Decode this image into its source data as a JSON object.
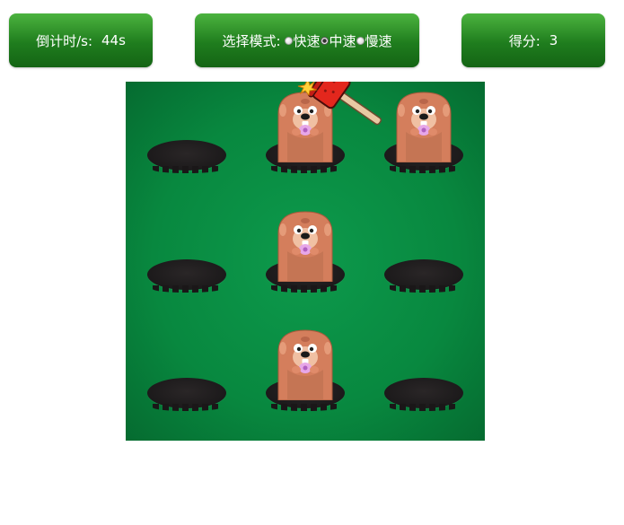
{
  "header": {
    "timer": {
      "label": "倒计时/s:",
      "value": "44s"
    },
    "mode": {
      "label": "选择模式:",
      "options": [
        {
          "label": "快速",
          "checked": false
        },
        {
          "label": "中速",
          "checked": true
        },
        {
          "label": "慢速",
          "checked": false
        }
      ]
    },
    "score": {
      "label": "得分:",
      "value": "3"
    }
  },
  "board": {
    "rows": 3,
    "cols": 3,
    "moles_up": [
      1,
      2,
      4,
      7
    ],
    "hit_mole": 1,
    "colors": {
      "grass": "#08883f",
      "hole": "#1f1c1d",
      "mole_body": "#d47e5c",
      "hammer_head": "#e3271d",
      "panel_green": "#2b8e28"
    }
  }
}
